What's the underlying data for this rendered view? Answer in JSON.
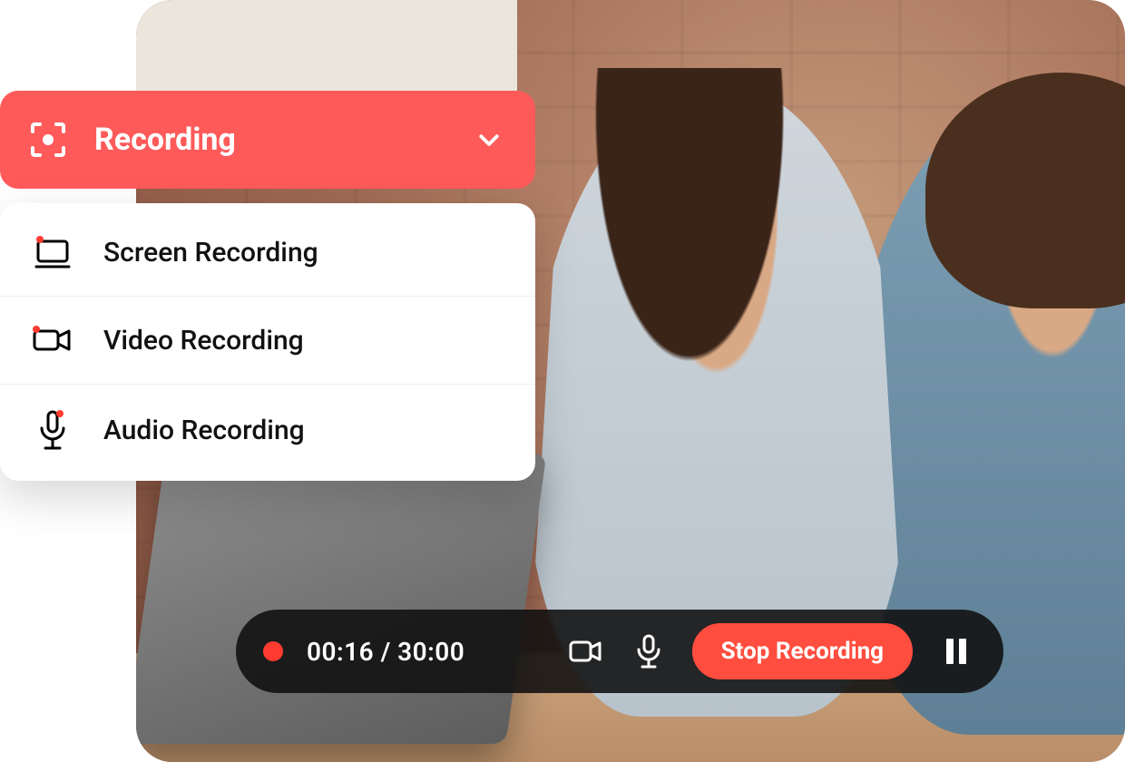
{
  "colors": {
    "accent": "#ff5a5a",
    "stop": "#ff4d3f",
    "rec_dot": "#ff3b30",
    "bar_bg": "rgba(15,15,15,0.88)"
  },
  "dropdown": {
    "header_label": "Recording",
    "items": [
      {
        "icon": "screen-record-icon",
        "label": "Screen Recording"
      },
      {
        "icon": "video-record-icon",
        "label": "Video Recording"
      },
      {
        "icon": "audio-record-icon",
        "label": "Audio Recording"
      }
    ]
  },
  "recbar": {
    "elapsed": "00:16",
    "separator": " / ",
    "total": "30:00",
    "time_display": "00:16 / 30:00",
    "stop_label": "Stop Recording"
  }
}
